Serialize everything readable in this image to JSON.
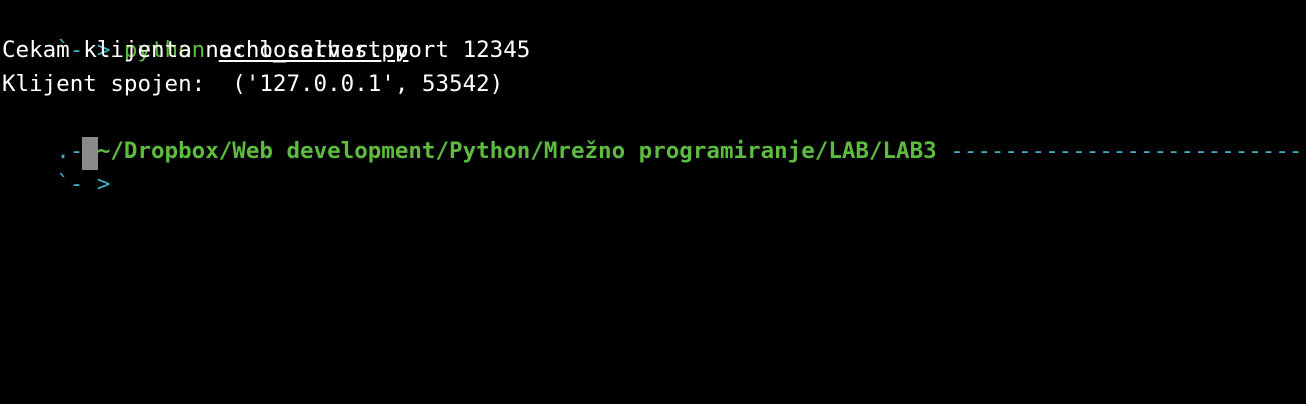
{
  "window": {
    "type": "terminal",
    "background": "#000000"
  },
  "colors": {
    "prompt": "#3fb0c6",
    "command": "#5dbb3f",
    "path": "#5dbb3f",
    "output": "#ffffff",
    "cursor": "#8a8a8a"
  },
  "lines": {
    "line1": {
      "prompt": "`- > ",
      "command": "python",
      "argument": "echo_server.py"
    },
    "line2": {
      "text": "Cekam klijenta na: localhost port 12345"
    },
    "line3": {
      "text": "Klijent spojen:  ('127.0.0.1', 53542)"
    },
    "line4": {
      "prefix": ".- ",
      "path": "~/Dropbox/Web development/Python/Mrežno programiranje/LAB/LAB3",
      "separator": " ---------------------------"
    },
    "line5": {
      "prompt": "`- > "
    }
  }
}
